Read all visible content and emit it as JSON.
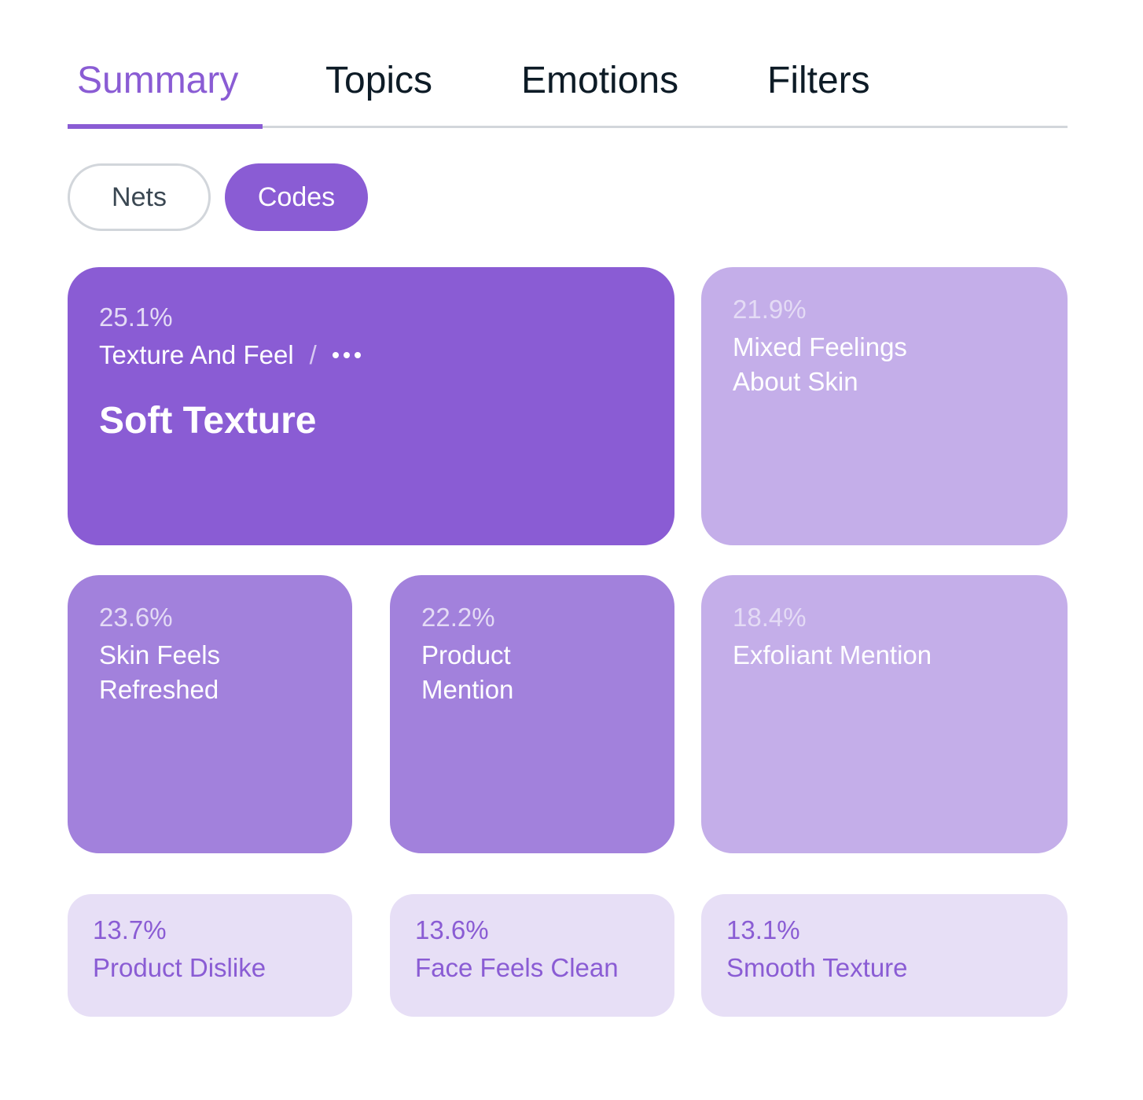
{
  "tabs": [
    {
      "label": "Summary",
      "active": true
    },
    {
      "label": "Topics",
      "active": false
    },
    {
      "label": "Emotions",
      "active": false
    },
    {
      "label": "Filters",
      "active": false
    }
  ],
  "toggle": {
    "nets_label": "Nets",
    "codes_label": "Codes",
    "selected": "Codes"
  },
  "colors": {
    "accent": "#8a5cd4",
    "tile_mid": "#a281dc",
    "tile_light": "#c4aee9",
    "tile_pale": "#e7dff6",
    "text_dark": "#0d1b26"
  },
  "tiles": [
    {
      "percent": "25.1%",
      "parent": "Texture And Feel",
      "separator": "/",
      "more_icon": "ellipsis-icon",
      "label": "Soft Texture",
      "shade": "dark"
    },
    {
      "percent": "21.9%",
      "label": "Mixed Feelings\nAbout Skin",
      "shade": "light"
    },
    {
      "percent": "23.6%",
      "label": "Skin Feels\nRefreshed",
      "shade": "mid"
    },
    {
      "percent": "22.2%",
      "label": "Product\nMention",
      "shade": "mid"
    },
    {
      "percent": "18.4%",
      "label": "Exfoliant Mention",
      "shade": "light"
    },
    {
      "percent": "13.7%",
      "label": "Product Dislike",
      "shade": "pale"
    },
    {
      "percent": "13.6%",
      "label": "Face Feels Clean",
      "shade": "pale"
    },
    {
      "percent": "13.1%",
      "label": "Smooth Texture",
      "shade": "pale"
    }
  ]
}
